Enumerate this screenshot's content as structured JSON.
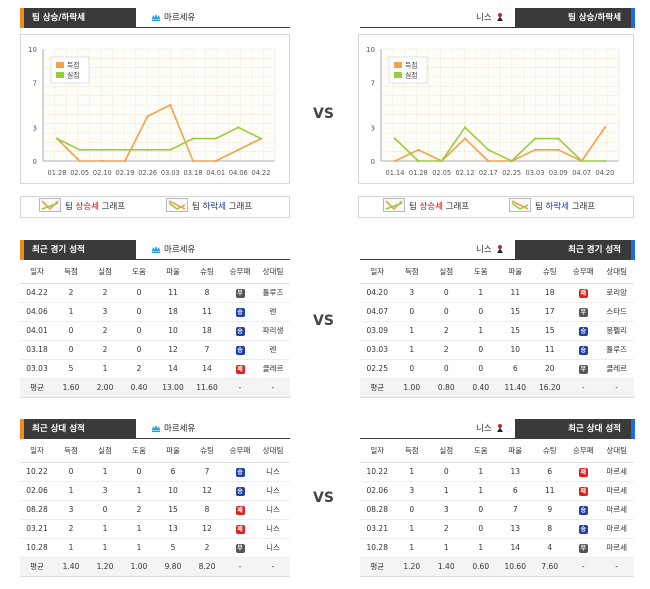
{
  "home_team": "마르세유",
  "away_team": "니스",
  "vs_label": "VS",
  "trend": {
    "title": "팀 상승/하락세",
    "legend_up_prefix": "팀",
    "legend_up_word": "상승세",
    "legend_down_prefix": "팀",
    "legend_down_word": "하락세",
    "legend_suffix": "그래프"
  },
  "chart_data": [
    {
      "type": "line",
      "team": "마르세유",
      "categories": [
        "01.28",
        "02.05",
        "02.10",
        "02.19",
        "02.26",
        "03.03",
        "03.18",
        "04.01",
        "04.06",
        "04.22"
      ],
      "ylim": [
        0,
        10
      ],
      "yticks": [
        0,
        3,
        7,
        10
      ],
      "grid": true,
      "legend_placement": "top-left",
      "series": [
        {
          "name": "득점",
          "color": "#f5a04a",
          "values": [
            2,
            0,
            0,
            0,
            4,
            5,
            0,
            0,
            1,
            2
          ]
        },
        {
          "name": "실점",
          "color": "#9ccc3c",
          "values": [
            2,
            1,
            1,
            1,
            1,
            1,
            2,
            2,
            3,
            2
          ]
        }
      ]
    },
    {
      "type": "line",
      "team": "니스",
      "categories": [
        "01.14",
        "01.28",
        "02.05",
        "02.12",
        "02.17",
        "02.25",
        "03.03",
        "03.09",
        "04.07",
        "04.20"
      ],
      "ylim": [
        0,
        10
      ],
      "yticks": [
        0,
        3,
        7,
        10
      ],
      "grid": true,
      "legend_placement": "top-left",
      "series": [
        {
          "name": "득점",
          "color": "#f5a04a",
          "values": [
            0,
            1,
            0,
            2,
            0,
            0,
            1,
            1,
            0,
            3
          ]
        },
        {
          "name": "실점",
          "color": "#9ccc3c",
          "values": [
            2,
            0,
            0,
            3,
            1,
            0,
            2,
            2,
            0,
            0
          ]
        }
      ]
    }
  ],
  "recent": {
    "title": "최근 경기 성적",
    "headers": [
      "일자",
      "득점",
      "실점",
      "도움",
      "파울",
      "슈팅",
      "승무패",
      "상대팀"
    ],
    "left": {
      "rows": [
        {
          "date": "04.22",
          "gf": "2",
          "ga": "2",
          "ast": "0",
          "foul": "11",
          "shot": "8",
          "res": "d",
          "opp": "툴루즈"
        },
        {
          "date": "04.06",
          "gf": "1",
          "ga": "3",
          "ast": "0",
          "foul": "18",
          "shot": "11",
          "res": "w",
          "opp": "렌"
        },
        {
          "date": "04.01",
          "gf": "0",
          "ga": "2",
          "ast": "0",
          "foul": "10",
          "shot": "18",
          "res": "w",
          "opp": "파리생"
        },
        {
          "date": "03.18",
          "gf": "0",
          "ga": "2",
          "ast": "0",
          "foul": "12",
          "shot": "7",
          "res": "w",
          "opp": "렌"
        },
        {
          "date": "03.03",
          "gf": "5",
          "ga": "1",
          "ast": "2",
          "foul": "14",
          "shot": "14",
          "res": "l",
          "opp": "클레르"
        }
      ],
      "avg": {
        "label": "평균",
        "gf": "1.60",
        "ga": "2.00",
        "ast": "0.40",
        "foul": "13.00",
        "shot": "11.60",
        "res": "-",
        "opp": "-"
      }
    },
    "right": {
      "rows": [
        {
          "date": "04.20",
          "gf": "3",
          "ga": "0",
          "ast": "1",
          "foul": "11",
          "shot": "18",
          "res": "l",
          "opp": "로리앙"
        },
        {
          "date": "04.07",
          "gf": "0",
          "ga": "0",
          "ast": "0",
          "foul": "15",
          "shot": "17",
          "res": "d",
          "opp": "스타드"
        },
        {
          "date": "03.09",
          "gf": "1",
          "ga": "2",
          "ast": "1",
          "foul": "15",
          "shot": "15",
          "res": "w",
          "opp": "몽펠리"
        },
        {
          "date": "03.03",
          "gf": "1",
          "ga": "2",
          "ast": "0",
          "foul": "10",
          "shot": "11",
          "res": "w",
          "opp": "툴루즈"
        },
        {
          "date": "02.25",
          "gf": "0",
          "ga": "0",
          "ast": "0",
          "foul": "6",
          "shot": "20",
          "res": "d",
          "opp": "클레르"
        }
      ],
      "avg": {
        "label": "평균",
        "gf": "1.00",
        "ga": "0.80",
        "ast": "0.40",
        "foul": "11.40",
        "shot": "16.20",
        "res": "-",
        "opp": "-"
      }
    }
  },
  "h2h": {
    "title": "최근 상대 성적",
    "headers": [
      "일자",
      "득점",
      "실점",
      "도움",
      "파울",
      "슈팅",
      "승무패",
      "상대팀"
    ],
    "left": {
      "rows": [
        {
          "date": "10.22",
          "gf": "0",
          "ga": "1",
          "ast": "0",
          "foul": "6",
          "shot": "7",
          "res": "w",
          "opp": "니스"
        },
        {
          "date": "02.06",
          "gf": "1",
          "ga": "3",
          "ast": "1",
          "foul": "10",
          "shot": "12",
          "res": "w",
          "opp": "니스"
        },
        {
          "date": "08.28",
          "gf": "3",
          "ga": "0",
          "ast": "2",
          "foul": "15",
          "shot": "8",
          "res": "l",
          "opp": "니스"
        },
        {
          "date": "03.21",
          "gf": "2",
          "ga": "1",
          "ast": "1",
          "foul": "13",
          "shot": "12",
          "res": "l",
          "opp": "니스"
        },
        {
          "date": "10.28",
          "gf": "1",
          "ga": "1",
          "ast": "1",
          "foul": "5",
          "shot": "2",
          "res": "d",
          "opp": "니스"
        }
      ],
      "avg": {
        "label": "평균",
        "gf": "1.40",
        "ga": "1.20",
        "ast": "1.00",
        "foul": "9.80",
        "shot": "8.20",
        "res": "-",
        "opp": "-"
      }
    },
    "right": {
      "rows": [
        {
          "date": "10.22",
          "gf": "1",
          "ga": "0",
          "ast": "1",
          "foul": "13",
          "shot": "6",
          "res": "l",
          "opp": "마르세"
        },
        {
          "date": "02.06",
          "gf": "3",
          "ga": "1",
          "ast": "1",
          "foul": "6",
          "shot": "11",
          "res": "l",
          "opp": "마르세"
        },
        {
          "date": "08.28",
          "gf": "0",
          "ga": "3",
          "ast": "0",
          "foul": "7",
          "shot": "9",
          "res": "w",
          "opp": "마르세"
        },
        {
          "date": "03.21",
          "gf": "1",
          "ga": "2",
          "ast": "0",
          "foul": "13",
          "shot": "8",
          "res": "w",
          "opp": "마르세"
        },
        {
          "date": "10.28",
          "gf": "1",
          "ga": "1",
          "ast": "1",
          "foul": "14",
          "shot": "4",
          "res": "d",
          "opp": "마르세"
        }
      ],
      "avg": {
        "label": "평균",
        "gf": "1.20",
        "ga": "1.40",
        "ast": "0.60",
        "foul": "10.60",
        "shot": "7.60",
        "res": "-",
        "opp": "-"
      }
    }
  },
  "result_glyphs": {
    "w": "승",
    "l": "패",
    "d": "무"
  },
  "colors": {
    "header_dark": "#3a3a3a",
    "accent_orange": "#f28c1e",
    "accent_blue": "#1d6fd8",
    "win": "#1d3fa8",
    "loss": "#e02020",
    "draw": "#555555"
  },
  "icons": {
    "home": "marseille-crest-icon",
    "away": "nice-crest-icon"
  }
}
